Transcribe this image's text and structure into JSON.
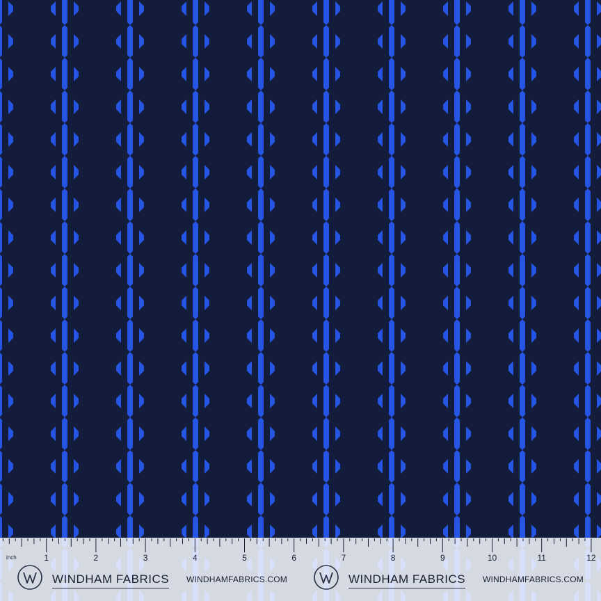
{
  "swatch": {
    "pattern": "diamond-stripe",
    "colors": {
      "ground": "#131c3a",
      "stripe": "#2655e4"
    }
  },
  "ruler": {
    "unit": "inch",
    "numbers": [
      "1",
      "2",
      "3",
      "4",
      "5",
      "6",
      "7",
      "8",
      "9",
      "10",
      "11",
      "12"
    ],
    "colors": {
      "background": "#f6f8fd",
      "ink": "#1a1f33"
    }
  },
  "branding": {
    "logo_icon": "windham-w-monogram-icon",
    "blocks": [
      {
        "name": "WINDHAM FABRICS",
        "url": "WINDHAMFABRICS.COM"
      },
      {
        "name": "WINDHAM FABRICS",
        "url": "WINDHAMFABRICS.COM"
      }
    ]
  }
}
